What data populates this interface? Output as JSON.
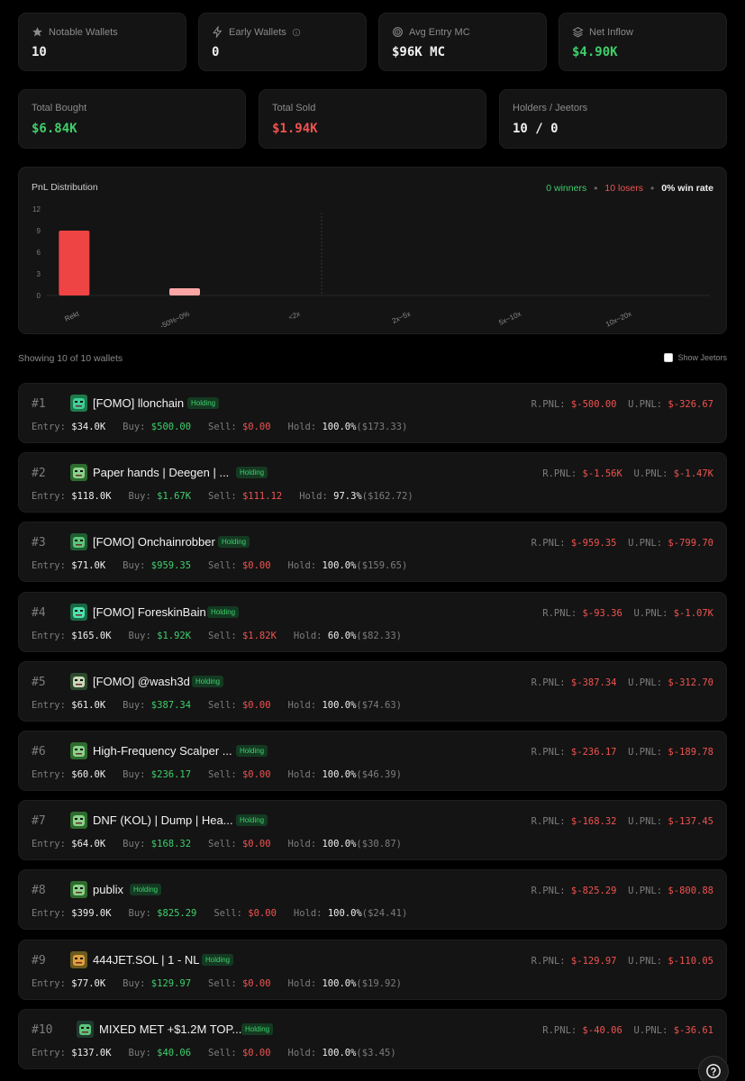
{
  "stats_top": [
    {
      "label": "Notable Wallets",
      "value": "10",
      "icon": "star-icon",
      "color": "white"
    },
    {
      "label": "Early Wallets",
      "value": "0",
      "icon": "lightning-icon",
      "color": "white"
    },
    {
      "label": "Avg Entry MC",
      "value": "$96K MC",
      "icon": "target-icon",
      "color": "white"
    },
    {
      "label": "Net Inflow",
      "value": "$4.90K",
      "icon": "layers-icon",
      "color": "green"
    }
  ],
  "stats_bottom": [
    {
      "label": "Total Bought",
      "value": "$6.84K",
      "color": "green"
    },
    {
      "label": "Total Sold",
      "value": "$1.94K",
      "color": "red"
    },
    {
      "label": "Holders / Jeetors",
      "value": "10 / 0",
      "color": "white"
    }
  ],
  "pnl": {
    "title": "PnL Distribution",
    "winners": "0 winners",
    "losers": "10 losers",
    "win_rate": "0% win rate"
  },
  "chart_data": {
    "type": "bar",
    "categories": [
      "Rekt",
      "-50%~0%",
      "<2x",
      "2x~5x",
      "5x~10x",
      "10x~20x"
    ],
    "values": [
      9,
      1,
      0,
      0,
      0,
      0
    ],
    "yticks": [
      "12",
      "9",
      "6",
      "3",
      "0"
    ],
    "ylim": [
      0,
      12
    ],
    "colors": [
      "#ef4444",
      "#fca5a5",
      "#ef4444",
      "#ef4444",
      "#ef4444",
      "#ef4444"
    ],
    "grid": false
  },
  "list": {
    "showing": "Showing 10 of 10 wallets",
    "show_jeetors": "Show Jeetors"
  },
  "labels": {
    "rpnl": "R.PNL:",
    "upnl": "U.PNL:",
    "entry": "Entry:",
    "buy": "Buy:",
    "sell": "Sell:",
    "hold": "Hold:"
  },
  "wallets": [
    {
      "rank": "#1",
      "name": "[FOMO] llonchain",
      "badge": "Holding",
      "rpnl": "$-500.00",
      "upnl": "$-326.67",
      "entry": "$34.0K",
      "buy": "$500.00",
      "sell": "$0.00",
      "hold": "100.0%",
      "hold_value": "($173.33)"
    },
    {
      "rank": "#2",
      "name": "Paper hands | Deegen | ...",
      "badge": "Holding",
      "rpnl": "$-1.56K",
      "upnl": "$-1.47K",
      "entry": "$118.0K",
      "buy": "$1.67K",
      "sell": "$111.12",
      "hold": "97.3%",
      "hold_value": "($162.72)"
    },
    {
      "rank": "#3",
      "name": "[FOMO] Onchainrobber",
      "badge": "Holding",
      "rpnl": "$-959.35",
      "upnl": "$-799.70",
      "entry": "$71.0K",
      "buy": "$959.35",
      "sell": "$0.00",
      "hold": "100.0%",
      "hold_value": "($159.65)"
    },
    {
      "rank": "#4",
      "name": "[FOMO] ForeskinBain",
      "badge": "Holding",
      "rpnl": "$-93.36",
      "upnl": "$-1.07K",
      "entry": "$165.0K",
      "buy": "$1.92K",
      "sell": "$1.82K",
      "hold": "60.0%",
      "hold_value": "($82.33)"
    },
    {
      "rank": "#5",
      "name": "[FOMO] @wash3d",
      "badge": "Holding",
      "rpnl": "$-387.34",
      "upnl": "$-312.70",
      "entry": "$61.0K",
      "buy": "$387.34",
      "sell": "$0.00",
      "hold": "100.0%",
      "hold_value": "($74.63)"
    },
    {
      "rank": "#6",
      "name": "High-Frequency Scalper ...",
      "badge": "Holding",
      "rpnl": "$-236.17",
      "upnl": "$-189.78",
      "entry": "$60.0K",
      "buy": "$236.17",
      "sell": "$0.00",
      "hold": "100.0%",
      "hold_value": "($46.39)"
    },
    {
      "rank": "#7",
      "name": "DNF (KOL) | Dump | Hea...",
      "badge": "Holding",
      "rpnl": "$-168.32",
      "upnl": "$-137.45",
      "entry": "$64.0K",
      "buy": "$168.32",
      "sell": "$0.00",
      "hold": "100.0%",
      "hold_value": "($30.87)"
    },
    {
      "rank": "#8",
      "name": "publix",
      "badge": "Holding",
      "rpnl": "$-825.29",
      "upnl": "$-800.88",
      "entry": "$399.0K",
      "buy": "$825.29",
      "sell": "$0.00",
      "hold": "100.0%",
      "hold_value": "($24.41)"
    },
    {
      "rank": "#9",
      "name": "444JET.SOL | 1 - NL",
      "badge": "Holding",
      "rpnl": "$-129.97",
      "upnl": "$-110.05",
      "entry": "$77.0K",
      "buy": "$129.97",
      "sell": "$0.00",
      "hold": "100.0%",
      "hold_value": "($19.92)"
    },
    {
      "rank": "#10",
      "name": "MIXED MET +$1.2M TOP...",
      "badge": "Holding",
      "rpnl": "$-40.06",
      "upnl": "$-36.61",
      "entry": "$137.0K",
      "buy": "$40.06",
      "sell": "$0.00",
      "hold": "100.0%",
      "hold_value": "($3.45)"
    }
  ],
  "help_icon": "help-circle-icon"
}
